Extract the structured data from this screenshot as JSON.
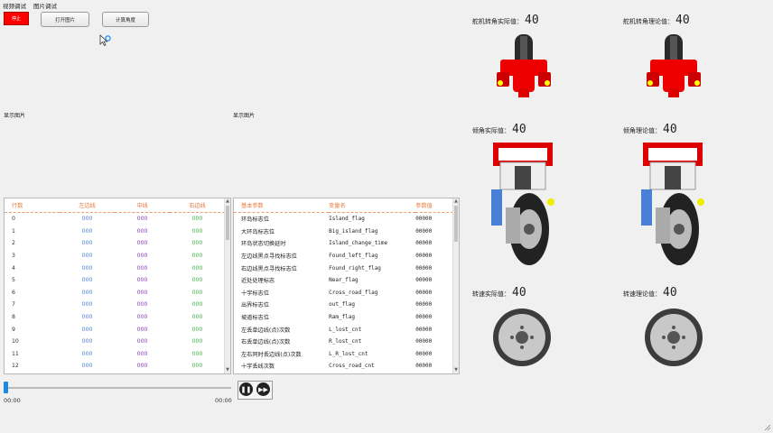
{
  "menu": [
    "视频调试",
    "图片调试"
  ],
  "toolbar": {
    "red_label": "停止",
    "open_image": "打开图片",
    "calc_angle": "计算角度"
  },
  "images": {
    "label_left": "显示图片",
    "label_right": "显示图片"
  },
  "line_table": {
    "headers": [
      "行数",
      "左边线",
      "中线",
      "右边线"
    ],
    "rows": [
      [
        "0",
        "000",
        "000",
        "000"
      ],
      [
        "1",
        "000",
        "000",
        "000"
      ],
      [
        "2",
        "000",
        "000",
        "000"
      ],
      [
        "3",
        "000",
        "000",
        "000"
      ],
      [
        "4",
        "000",
        "000",
        "000"
      ],
      [
        "5",
        "000",
        "000",
        "000"
      ],
      [
        "6",
        "000",
        "000",
        "000"
      ],
      [
        "7",
        "000",
        "000",
        "000"
      ],
      [
        "8",
        "000",
        "000",
        "000"
      ],
      [
        "9",
        "000",
        "000",
        "000"
      ],
      [
        "10",
        "000",
        "000",
        "000"
      ],
      [
        "11",
        "000",
        "000",
        "000"
      ],
      [
        "12",
        "000",
        "000",
        "000"
      ]
    ]
  },
  "param_table": {
    "headers": [
      "基本参数",
      "变量名",
      "参数值"
    ],
    "rows": [
      [
        "环岛标志位",
        "Island_flag",
        "00000"
      ],
      [
        "大环岛标志位",
        "Big_island_flag",
        "00000"
      ],
      [
        "环岛状态切换延时",
        "Island_change_time",
        "00000"
      ],
      [
        "左边线黑点寻找标志位",
        "Found_left_flag",
        "00000"
      ],
      [
        "右边线黑点寻找标志位",
        "Found_right_flag",
        "00000"
      ],
      [
        "近处处理标志",
        "Near_flag",
        "00000"
      ],
      [
        "十字标志位",
        "Cross_road_flag",
        "00000"
      ],
      [
        "出界标志位",
        "out_flag",
        "00000"
      ],
      [
        "坡道标志位",
        "Ram_flag",
        "00000"
      ],
      [
        "左丢单边线(点)次数",
        "L_lost_cnt",
        "00000"
      ],
      [
        "右丢单边线(点)次数",
        "R_lost_cnt",
        "00000"
      ],
      [
        "左右同时丢边线(点)次数",
        "L_R_lost_cnt",
        "00000"
      ],
      [
        "十字丢线次数",
        "Cross_road_cnt",
        "00000"
      ]
    ]
  },
  "player": {
    "time_start": "00:00",
    "time_end": "00:00",
    "progress": 0
  },
  "gauges": [
    {
      "label": "舵机转角实际值：",
      "value": "40",
      "kind": "wheel-front"
    },
    {
      "label": "舵机转角理论值：",
      "value": "40",
      "kind": "wheel-front"
    },
    {
      "label": "倾角实际值：",
      "value": "40",
      "kind": "wheel-side"
    },
    {
      "label": "倾角理论值：",
      "value": "40",
      "kind": "wheel-side"
    },
    {
      "label": "转速实际值：",
      "value": "40",
      "kind": "wheel-disc"
    },
    {
      "label": "转速理论值：",
      "value": "40",
      "kind": "wheel-disc"
    }
  ],
  "colors": {
    "accent_red": "#ff0000",
    "header_orange": "#e87a3c",
    "progress_blue": "#1e88e5"
  }
}
